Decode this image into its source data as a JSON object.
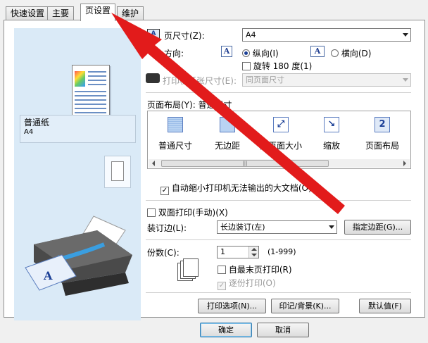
{
  "tabs": [
    {
      "label": "快速设置"
    },
    {
      "label": "主要"
    },
    {
      "label": "页设置"
    },
    {
      "label": "维护"
    }
  ],
  "preview": {
    "paper_type": "普通纸",
    "paper_size": "A4"
  },
  "page_size": {
    "label": "页尺寸(Z):",
    "value": "A4"
  },
  "orientation": {
    "label": "方向:",
    "portrait_label": "纵向(I)",
    "landscape_label": "横向(D)",
    "rotate_label": "旋转 180 度(1)",
    "selected": "portrait"
  },
  "printer_paper_size": {
    "label": "打印机纸张尺寸(E):",
    "value": "同页面尺寸"
  },
  "page_layout": {
    "label": "页面布局(Y): 普通尺寸",
    "items": [
      {
        "label": "普通尺寸",
        "icon": "normal-size-icon"
      },
      {
        "label": "无边距",
        "icon": "borderless-icon"
      },
      {
        "label": "按页面大小",
        "icon": "fit-to-page-icon"
      },
      {
        "label": "缩放",
        "icon": "scaled-icon"
      },
      {
        "label": "页面布局",
        "icon": "page-layout-icon"
      }
    ]
  },
  "auto_reduce": {
    "label": "自动缩小打印机无法输出的大文档(O)",
    "checked": true
  },
  "duplex": {
    "label": "双面打印(手动)(X)",
    "checked": false
  },
  "stapling": {
    "label": "装订边(L):",
    "value": "长边装订(左)"
  },
  "margin_button": "指定边距(G)...",
  "copies": {
    "label": "份数(C):",
    "value": "1",
    "range": "(1-999)"
  },
  "last_page_first": {
    "label": "自最末页打印(R)",
    "checked": false
  },
  "collate": {
    "label": "逐份打印(O)",
    "checked": true
  },
  "buttons": {
    "print_options": "打印选项(N)...",
    "stamp_background": "印记/背景(K)...",
    "defaults": "默认值(F)"
  },
  "footer": {
    "ok": "确定",
    "cancel": "取消"
  },
  "colors": {
    "accent": "#1b3f96",
    "preview_bg": "#daeaf7",
    "arrow": "#e21b1b"
  }
}
